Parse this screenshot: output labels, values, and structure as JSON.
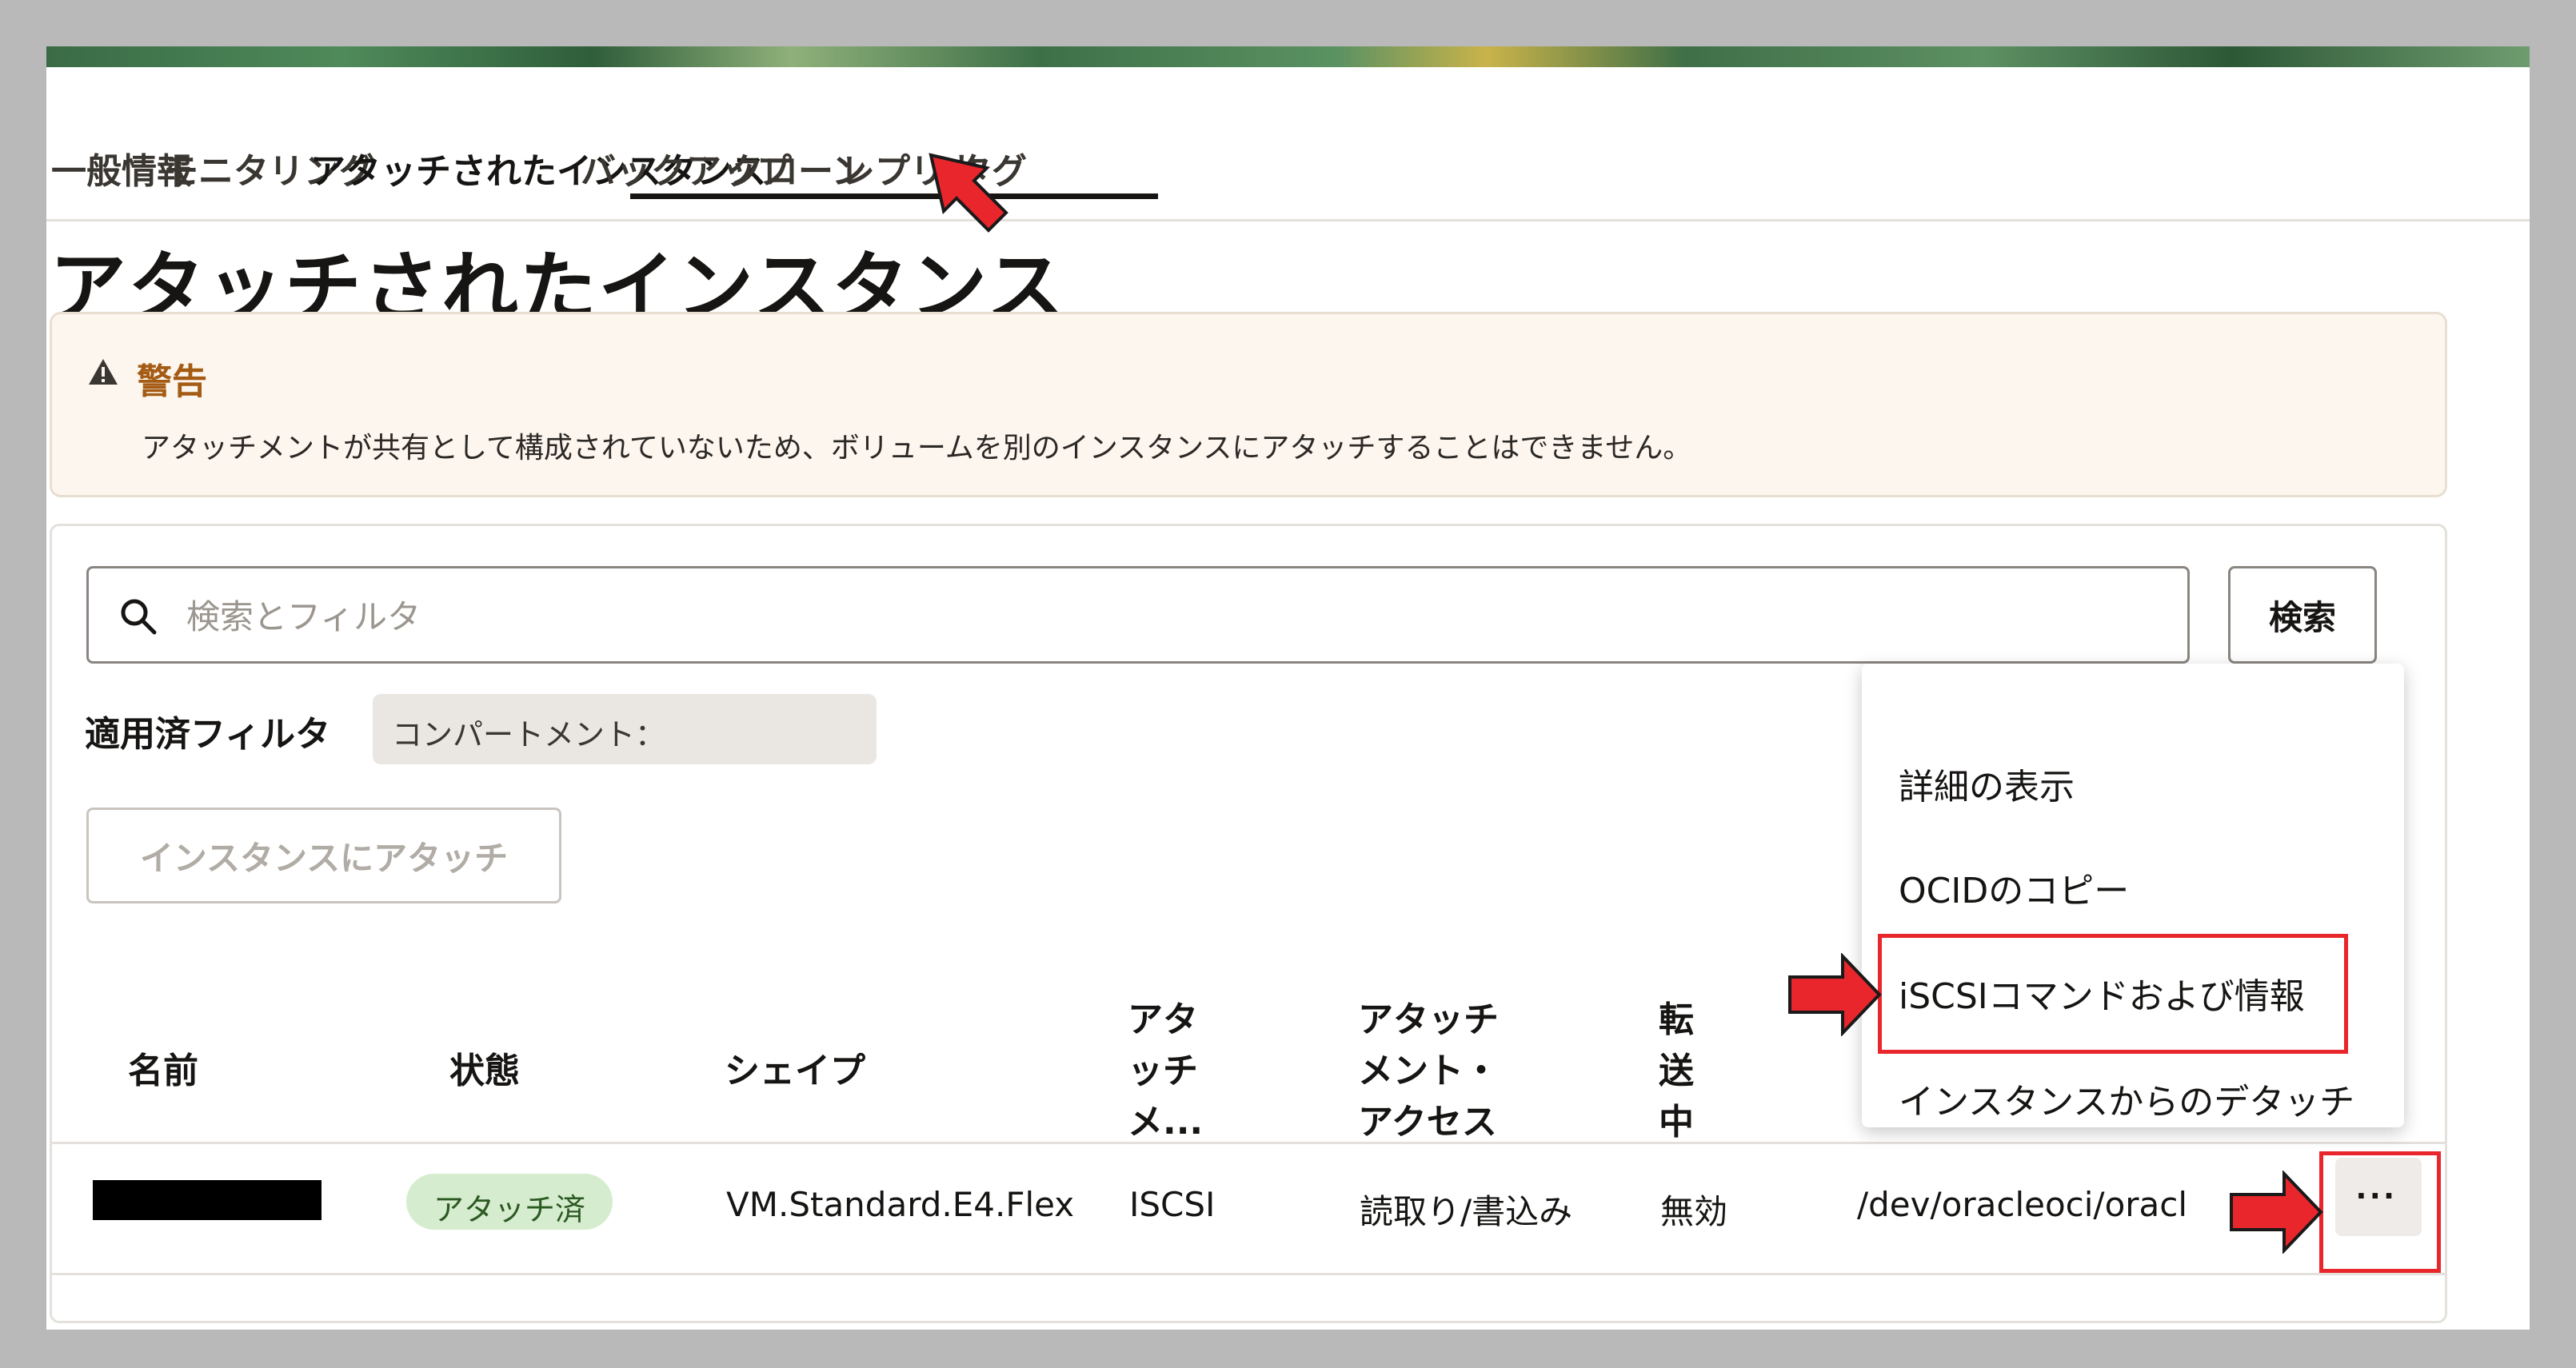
{
  "tabs": [
    {
      "label": "一般情報"
    },
    {
      "label": "モニタリング"
    },
    {
      "label": "アタッチされたインスタンス"
    },
    {
      "label": "バックアップ"
    },
    {
      "label": "クローン"
    },
    {
      "label": "レプリカ"
    },
    {
      "label": "タグ"
    }
  ],
  "active_tab": "アタッチされたインスタンス",
  "page_title": "アタッチされたインスタンス",
  "warning": {
    "title": "警告",
    "text": "アタッチメントが共有として構成されていないため、ボリュームを別のインスタンスにアタッチすることはできません。"
  },
  "search": {
    "placeholder": "検索とフィルタ",
    "value": "",
    "button_label": "検索"
  },
  "filters": {
    "label": "適用済フィルタ",
    "chip": "コンパートメント："
  },
  "attach_button": "インスタンスにアタッチ",
  "table": {
    "headers": {
      "name": "名前",
      "state": "状態",
      "shape": "シェイプ",
      "attach_type": [
        "アタ",
        "ッチ",
        "メ..."
      ],
      "access": [
        "アタッチ",
        "メント・",
        "アクセス"
      ],
      "in_transit": [
        "転",
        "送",
        "中"
      ]
    },
    "rows": [
      {
        "name": "",
        "state": "アタッチ済",
        "shape": "VM.Standard.E4.Flex",
        "attach_type": "ISCSI",
        "access": "読取り/書込み",
        "in_transit": "無効",
        "device": "/dev/oracleoci/oracl"
      }
    ]
  },
  "context_menu": {
    "items": [
      {
        "label": "詳細の表示"
      },
      {
        "label": "OCIDのコピー"
      },
      {
        "label": "iSCSIコマンドおよび情報"
      },
      {
        "label": "インスタンスからのデタッチ"
      }
    ]
  },
  "icons": {
    "search": "search-icon",
    "warning": "warning-icon",
    "kebab": "more-actions-icon"
  },
  "colors": {
    "warning_title": "#a45b14",
    "status_badge_bg": "#d5ecce",
    "highlight": "#e8262b"
  }
}
